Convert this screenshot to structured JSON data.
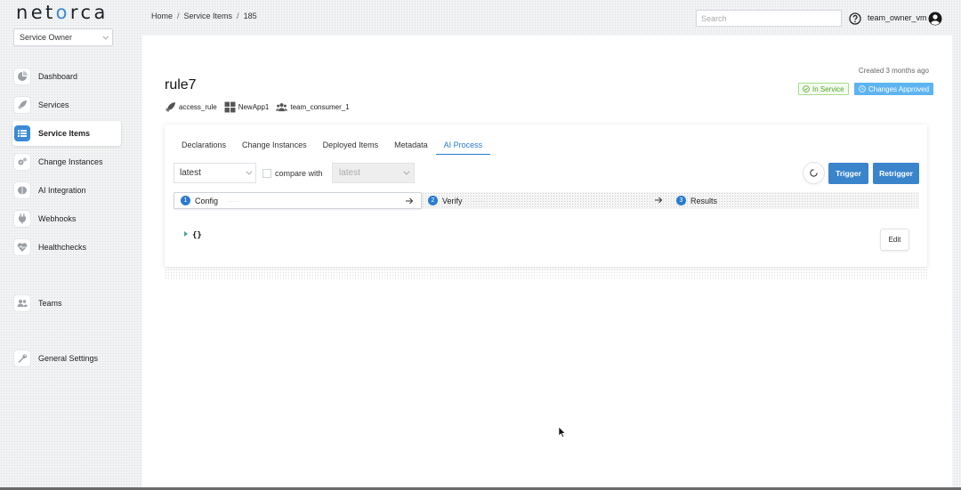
{
  "app": {
    "logo_text_1": "net",
    "logo_text_2": "o",
    "logo_text_3": "rca",
    "role": "Service Owner",
    "accent_color": "#3a8ad6"
  },
  "sidebar": {
    "items": [
      {
        "label": "Dashboard",
        "icon": "pie-chart-icon"
      },
      {
        "label": "Services",
        "icon": "rocket-icon"
      },
      {
        "label": "Service Items",
        "icon": "list-icon",
        "active": true
      },
      {
        "label": "Change Instances",
        "icon": "gears-icon"
      },
      {
        "label": "AI Integration",
        "icon": "brain-icon"
      },
      {
        "label": "Webhooks",
        "icon": "plug-icon"
      },
      {
        "label": "Healthchecks",
        "icon": "heartbeat-icon"
      },
      {
        "label": "Teams",
        "icon": "users-icon"
      },
      {
        "label": "General Settings",
        "icon": "wrench-icon"
      }
    ]
  },
  "header": {
    "breadcrumb": [
      "Home",
      "Service Items",
      "185"
    ],
    "separator": "/",
    "search_placeholder": "Search",
    "user_name": "team_owner_vm"
  },
  "item": {
    "title": "rule7",
    "created": "Created 3 months ago",
    "service": "access_rule",
    "application": "NewApp1",
    "team": "team_consumer_1",
    "status_badge": "In Service",
    "status_color": "#52a52a",
    "approval_badge": "Changes Approved",
    "approval_color": "#5eb4f0"
  },
  "tabs": [
    "Declarations",
    "Change Instances",
    "Deployed Items",
    "Metadata",
    "AI Process"
  ],
  "active_tab": "AI Process",
  "ai_process": {
    "version_value": "latest",
    "compare_label": "compare with",
    "compare_value": "latest",
    "trigger_label": "Trigger",
    "retrigger_label": "Retrigger",
    "steps": [
      {
        "num": "1",
        "label": "Config",
        "dots": "....."
      },
      {
        "num": "2",
        "label": "Verify",
        "dots": "....."
      },
      {
        "num": "3",
        "label": "Results",
        "dots": "....."
      }
    ],
    "json_value": "{}",
    "edit_label": "Edit"
  }
}
